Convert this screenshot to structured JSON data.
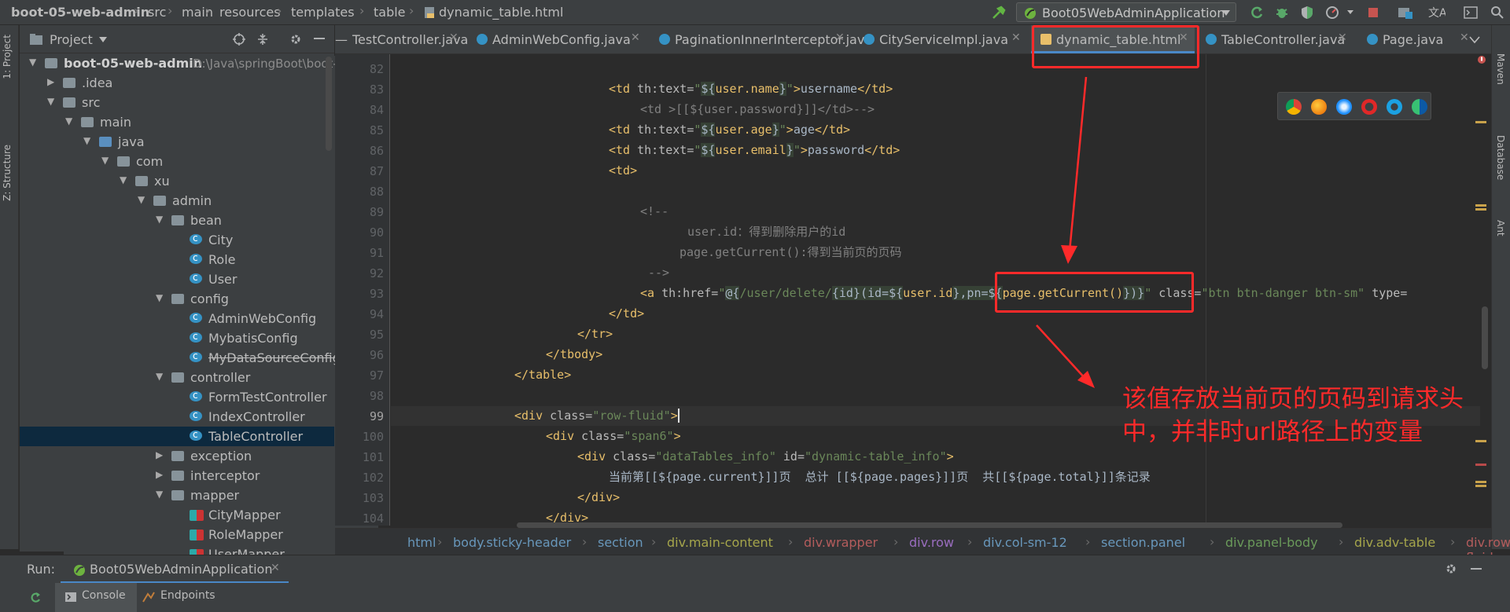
{
  "breadcrumbs": [
    "boot-05-web-admin",
    "src",
    "main",
    "resources",
    "templates",
    "table",
    "dynamic_table.html"
  ],
  "run_config": "Boot05WebAdminApplication",
  "left_strip": [
    "1: Project",
    "Z: Structure"
  ],
  "right_strip": [
    "Maven",
    "Database",
    "Ant"
  ],
  "project_panel": {
    "title": "Project"
  },
  "tree": [
    {
      "label": "boot-05-web-admin",
      "path": "D:\\Java\\springBoot\\boot-",
      "depth": 0,
      "kind": "proj",
      "arrow": "▼"
    },
    {
      "label": ".idea",
      "depth": 1,
      "kind": "folder",
      "arrow": "▶"
    },
    {
      "label": "src",
      "depth": 1,
      "kind": "folder",
      "arrow": "▼"
    },
    {
      "label": "main",
      "depth": 2,
      "kind": "folder",
      "arrow": "▼"
    },
    {
      "label": "java",
      "depth": 3,
      "kind": "blue",
      "arrow": "▼"
    },
    {
      "label": "com",
      "depth": 4,
      "kind": "folder",
      "arrow": "▼"
    },
    {
      "label": "xu",
      "depth": 5,
      "kind": "folder",
      "arrow": "▼"
    },
    {
      "label": "admin",
      "depth": 6,
      "kind": "folder",
      "arrow": "▼"
    },
    {
      "label": "bean",
      "depth": 7,
      "kind": "folder",
      "arrow": "▼"
    },
    {
      "label": "City",
      "depth": 8,
      "kind": "class"
    },
    {
      "label": "Role",
      "depth": 8,
      "kind": "class"
    },
    {
      "label": "User",
      "depth": 8,
      "kind": "class"
    },
    {
      "label": "config",
      "depth": 7,
      "kind": "folder",
      "arrow": "▼"
    },
    {
      "label": "AdminWebConfig",
      "depth": 8,
      "kind": "class"
    },
    {
      "label": "MybatisConfig",
      "depth": 8,
      "kind": "class"
    },
    {
      "label": "MyDataSourceConfig",
      "depth": 8,
      "kind": "class",
      "strike": true
    },
    {
      "label": "controller",
      "depth": 7,
      "kind": "folder",
      "arrow": "▼"
    },
    {
      "label": "FormTestController",
      "depth": 8,
      "kind": "class"
    },
    {
      "label": "IndexController",
      "depth": 8,
      "kind": "class"
    },
    {
      "label": "TableController",
      "depth": 8,
      "kind": "class",
      "selected": true
    },
    {
      "label": "exception",
      "depth": 7,
      "kind": "folder",
      "arrow": "▶"
    },
    {
      "label": "interceptor",
      "depth": 7,
      "kind": "folder",
      "arrow": "▶"
    },
    {
      "label": "mapper",
      "depth": 7,
      "kind": "folder",
      "arrow": "▼"
    },
    {
      "label": "CityMapper",
      "depth": 8,
      "kind": "mapper"
    },
    {
      "label": "RoleMapper",
      "depth": 8,
      "kind": "mapper"
    },
    {
      "label": "UserMapper",
      "depth": 8,
      "kind": "mapper"
    }
  ],
  "tabs": [
    {
      "label": "TestController.java"
    },
    {
      "label": "AdminWebConfig.java"
    },
    {
      "label": "PaginationInnerInterceptor.java"
    },
    {
      "label": "CityServiceImpl.java"
    },
    {
      "label": "dynamic_table.html",
      "active": true
    },
    {
      "label": "TableController.java"
    },
    {
      "label": "Page.java"
    }
  ],
  "line_numbers": [
    "82",
    "83",
    "84",
    "85",
    "86",
    "87",
    "88",
    "89",
    "90",
    "91",
    "92",
    "93",
    "94",
    "95",
    "96",
    "97",
    "98",
    "99",
    "100",
    "101",
    "102",
    "103",
    "104"
  ],
  "current_line": "99",
  "annotation": {
    "line1": "该值存放当前页的页码到请求头",
    "line2": "中，并非时url路径上的变量"
  },
  "breadcrumb_path": [
    "html",
    "body.sticky-header",
    "section",
    "div.main-content",
    "div.wrapper",
    "div.row",
    "div.col-sm-12",
    "section.panel",
    "div.panel-body",
    "div.adv-table",
    "div.row-fluid"
  ],
  "breadcrumb_colors": [
    "#6897bb",
    "#6897bb",
    "#6897bb",
    "#a5a54b",
    "#b35c5c",
    "#9a6dbf",
    "#6897bb",
    "#6897bb",
    "#6a9a5a",
    "#a5a54b",
    "#b35c5c"
  ],
  "run": {
    "label": "Run:",
    "config": "Boot05WebAdminApplication"
  },
  "bottom_tabs": [
    "Console",
    "Endpoints"
  ]
}
